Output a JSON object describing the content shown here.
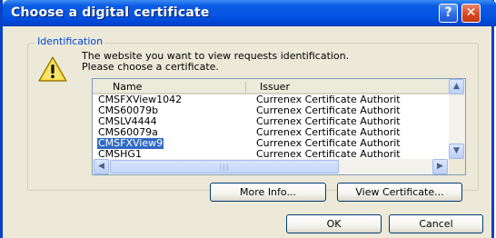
{
  "window": {
    "title": "Choose a digital certificate"
  },
  "titlebar": {
    "help_label": "?",
    "close_label": "✕"
  },
  "group": {
    "legend": "Identification"
  },
  "message": {
    "line1": "The website you want to view requests identification.",
    "line2": "Please choose a certificate."
  },
  "list": {
    "columns": [
      "Name",
      "Issuer"
    ],
    "rows": [
      {
        "name": "CMSFXView1042",
        "issuer": "Currenex Certificate Authorit"
      },
      {
        "name": "CMS60079b",
        "issuer": "Currenex Certificate Authorit"
      },
      {
        "name": "CMSLV4444",
        "issuer": "Currenex Certificate Authorit"
      },
      {
        "name": "CMS60079a",
        "issuer": "Currenex Certificate Authorit"
      },
      {
        "name": "CMSFXView9",
        "issuer": "Currenex Certificate Authorit"
      },
      {
        "name": "CMSHG1",
        "issuer": "Currenex Certificate Authorit"
      }
    ],
    "selected_name": "CMSFXView9"
  },
  "buttons": {
    "more_info": "More Info...",
    "view_certificate": "View Certificate...",
    "ok": "OK",
    "cancel": "Cancel"
  },
  "colors": {
    "title_bar": "#0554e3",
    "selection": "#316ac5",
    "dialog_bg": "#ece9d8"
  },
  "icons": {
    "warning": "warning-icon",
    "help": "help-icon",
    "close": "close-icon"
  }
}
